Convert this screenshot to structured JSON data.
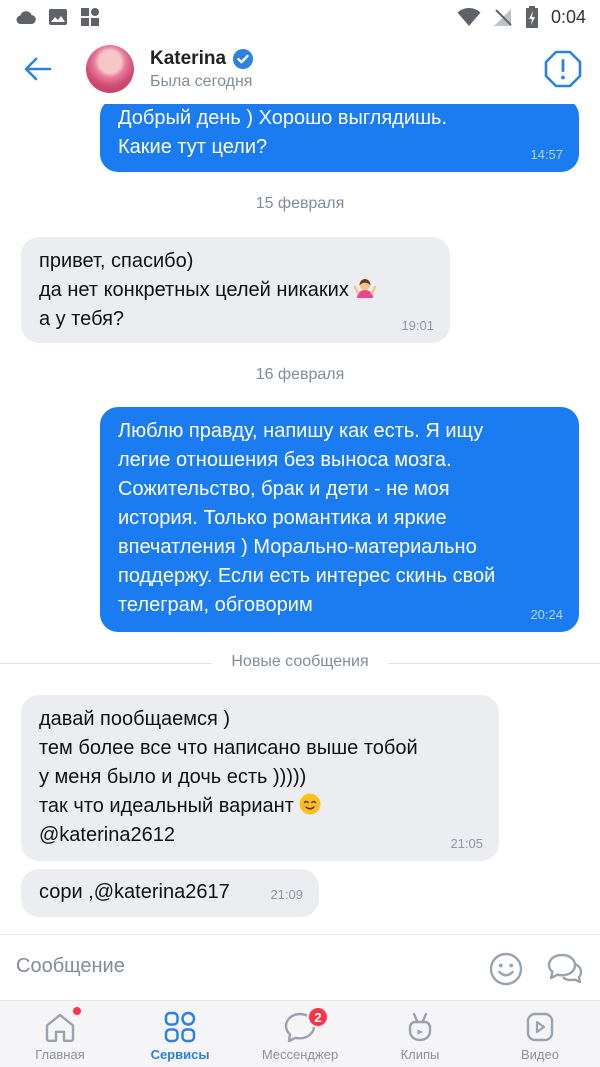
{
  "status_bar": {
    "time": "0:04",
    "left_icons": [
      "cloud-icon",
      "image-icon",
      "apps-grid-icon"
    ],
    "right_icons": [
      "wifi-icon",
      "no-signal-icon",
      "battery-charging-icon"
    ]
  },
  "header": {
    "contact_name": "Katerina",
    "verified_icon": "verified-check-icon",
    "last_seen": "Была сегодня",
    "report_icon": "alert-octagon-icon"
  },
  "messages": [
    {
      "direction": "out",
      "lines": [
        "Добрый день ) Хорошо выглядишь.",
        "Какие тут цели?"
      ],
      "time": "14:57"
    },
    {
      "direction": "out",
      "lines": [
        "Люблю правду, напишу как есть. Я ищу",
        "легие отношения без выноса мозга.",
        "Сожительство, брак и дети - не моя",
        "история. Только романтика и яркие",
        "впечатления ) Морально-материально",
        "поддержу. Если есть интерес скинь свой",
        "телеграм, обговорим"
      ],
      "time": "20:24"
    }
  ],
  "incoming": [
    {
      "lines": [
        "привет, спасибо)",
        "да нет конкретных целей никаких",
        "а у тебя?"
      ],
      "time": "19:01",
      "emoji": "woman-shrugging"
    },
    {
      "lines": [
        "давай пообщаемся )",
        "тем более все что написано выше тобой",
        "у меня было и дочь есть )))))",
        "так что идеальный вариант",
        "@katerina2612"
      ],
      "time": "21:05",
      "emoji": "smiling-face"
    },
    {
      "lines": [
        "сори ,@katerina2617"
      ],
      "time": "21:09"
    }
  ],
  "date_separators": [
    "15 февраля",
    "16 февраля"
  ],
  "new_messages_label": "Новые сообщения",
  "composer": {
    "placeholder": "Сообщение",
    "emoji_icon": "smile-icon",
    "voice_icon": "chat-bubbles-icon"
  },
  "tabs": [
    {
      "label": "Главная",
      "icon": "home-icon",
      "active": false,
      "has_dot": true
    },
    {
      "label": "Сервисы",
      "icon": "services-grid-icon",
      "active": true
    },
    {
      "label": "Мессенджер",
      "icon": "messenger-icon",
      "active": false,
      "badge": "2"
    },
    {
      "label": "Клипы",
      "icon": "clips-icon",
      "active": false
    },
    {
      "label": "Видео",
      "icon": "video-icon",
      "active": false
    }
  ],
  "colors": {
    "accent": "#2d81e0",
    "outgoing_bubble": "#1a7cf0",
    "incoming_bubble": "#ebedf0",
    "badge": "#ff3347"
  }
}
